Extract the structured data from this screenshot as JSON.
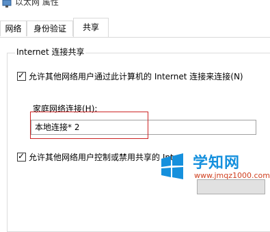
{
  "window": {
    "title": "以太网 属性"
  },
  "tabs": [
    {
      "label": "网络",
      "active": false
    },
    {
      "label": "身份验证",
      "active": false
    },
    {
      "label": "共享",
      "active": true
    }
  ],
  "sharing": {
    "group_title": "Internet 连接共享",
    "allow_share": {
      "label": "允许其他网络用户通过此计算机的 Internet 连接来连接(N)",
      "checked": true
    },
    "home_network": {
      "label": "家庭网络连接(H):",
      "value": "本地连接* 2"
    },
    "allow_control": {
      "label": "允许其他网络用户控制或禁用共享的 Inte",
      "checked": true
    }
  },
  "watermark": {
    "title": "学知网",
    "url": "www.jmqz1000.com"
  },
  "colors": {
    "highlight": "#cc2222",
    "brand": "#1590dd",
    "brand_url": "#d04020"
  }
}
